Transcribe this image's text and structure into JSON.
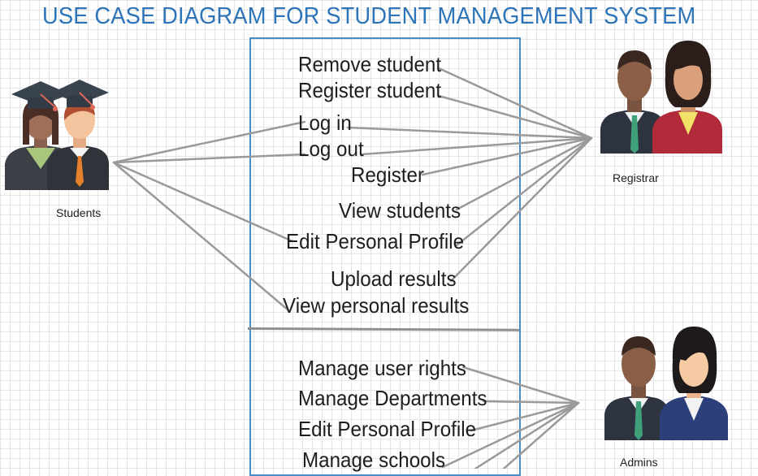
{
  "title": "USE CASE DIAGRAM FOR STUDENT MANAGEMENT SYSTEM",
  "actors": {
    "students": "Students",
    "registrar": "Registrar",
    "admins": "Admins"
  },
  "use_cases": {
    "remove_student": "Remove student",
    "register_student": "Register student",
    "log_in": "Log in",
    "log_out": "Log out",
    "register": "Register",
    "view_students": "View students",
    "edit_profile_upper": "Edit Personal Profile",
    "upload_results": "Upload results",
    "view_personal_results": "View personal results",
    "manage_user_rights": "Manage user rights",
    "manage_departments": "Manage Departments",
    "edit_profile_lower": "Edit Personal Profile",
    "manage_schools": "Manage schools"
  },
  "associations": {
    "Students": [
      "log_in",
      "log_out",
      "edit_profile_upper",
      "view_personal_results"
    ],
    "Registrar": [
      "remove_student",
      "register_student",
      "log_in",
      "log_out",
      "register",
      "view_students",
      "edit_profile_upper",
      "upload_results"
    ],
    "Admins": [
      "manage_user_rights",
      "manage_departments",
      "edit_profile_lower",
      "manage_schools"
    ]
  },
  "colors": {
    "title": "#2d74b8",
    "system_border": "#4a8cc8",
    "connector": "#9a9a9a"
  }
}
